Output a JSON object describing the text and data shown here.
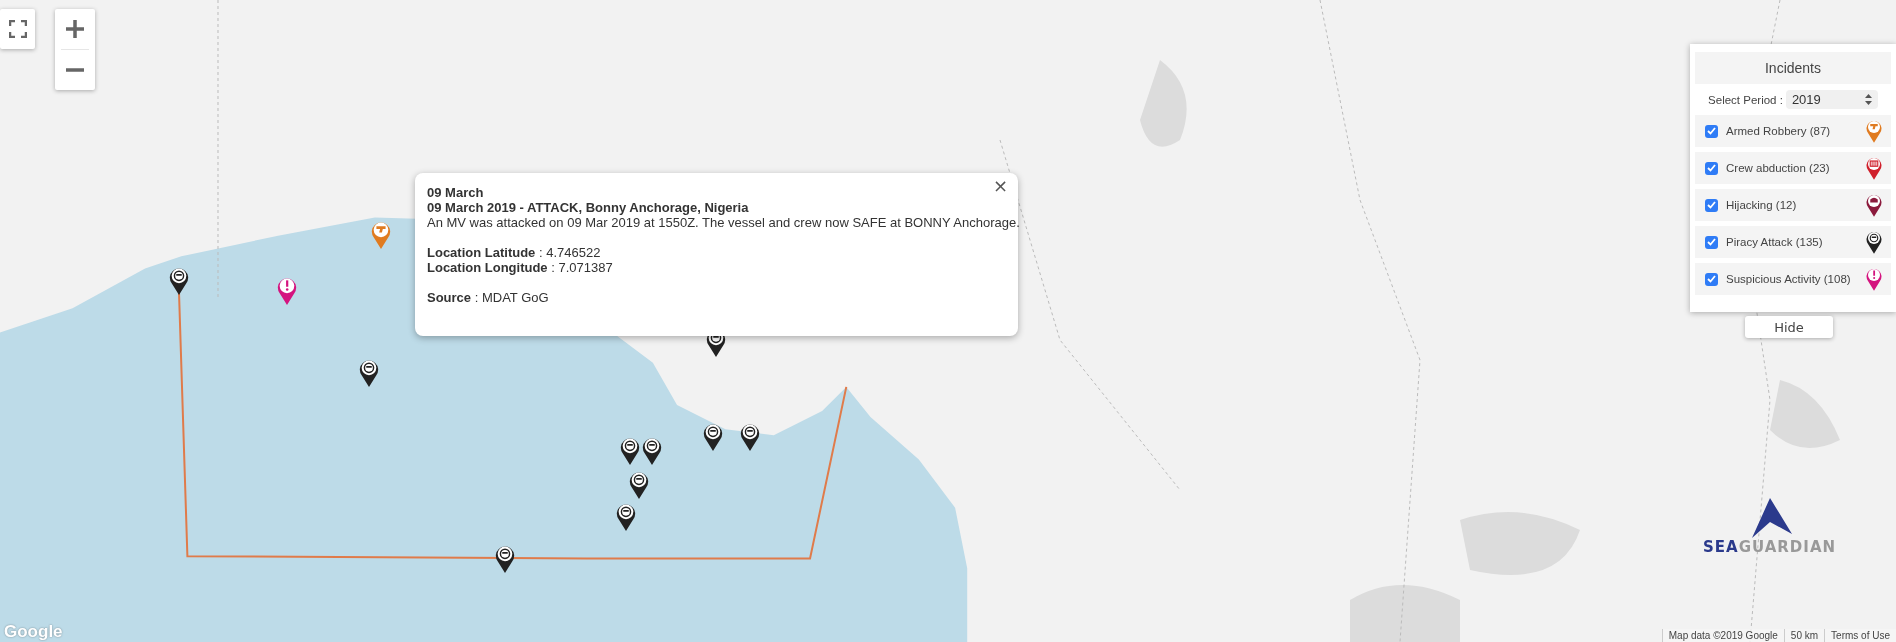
{
  "map": {
    "markers": [
      {
        "kind": "armed"
      },
      {
        "kind": "suspicious"
      },
      {
        "kind": "piracy"
      },
      {
        "kind": "piracy"
      },
      {
        "kind": "piracy"
      },
      {
        "kind": "piracy"
      },
      {
        "kind": "piracy"
      },
      {
        "kind": "piracy"
      },
      {
        "kind": "piracy"
      },
      {
        "kind": "piracy"
      },
      {
        "kind": "piracy"
      },
      {
        "kind": "piracy"
      }
    ],
    "attribution": [
      "Map data ©2019 Google",
      "50 km",
      "Terms of Use"
    ],
    "brand": "Google"
  },
  "logo": {
    "part_1": "SEA",
    "part_2": "GUARDIAN"
  },
  "popup": {
    "title": "09 March",
    "headline": "09 March 2019 - ATTACK, Bonny Anchorage, Nigeria",
    "body": "An MV was attacked on 09 Mar 2019 at 1550Z. The vessel and crew now SAFE at BONNY Anchorage.",
    "fields": [
      "**Location Latitude** : 4.746522",
      "**Location Longitude** : 7.071387",
      "**Source** : MDAT GoG"
    ],
    "close": "×"
  },
  "legend": {
    "title": "Incidents",
    "period_label": "Select Period :",
    "period": "2019",
    "categories": [
      {
        "kind": "armed",
        "label": "Armed Robbery (87)",
        "checked": true,
        "color": "#e07b20"
      },
      {
        "kind": "crew",
        "label": "Crew abduction (23)",
        "checked": true,
        "color": "#d0202c"
      },
      {
        "kind": "hijacking",
        "label": "Hijacking (12)",
        "checked": true,
        "color": "#8b1a3c"
      },
      {
        "kind": "piracy",
        "label": "Piracy Attack (135)",
        "checked": true,
        "color": "#222222"
      },
      {
        "kind": "suspicious",
        "label": "Suspicious Activity (108)",
        "checked": true,
        "color": "#d4147f"
      }
    ],
    "hide_button": "Hide"
  }
}
